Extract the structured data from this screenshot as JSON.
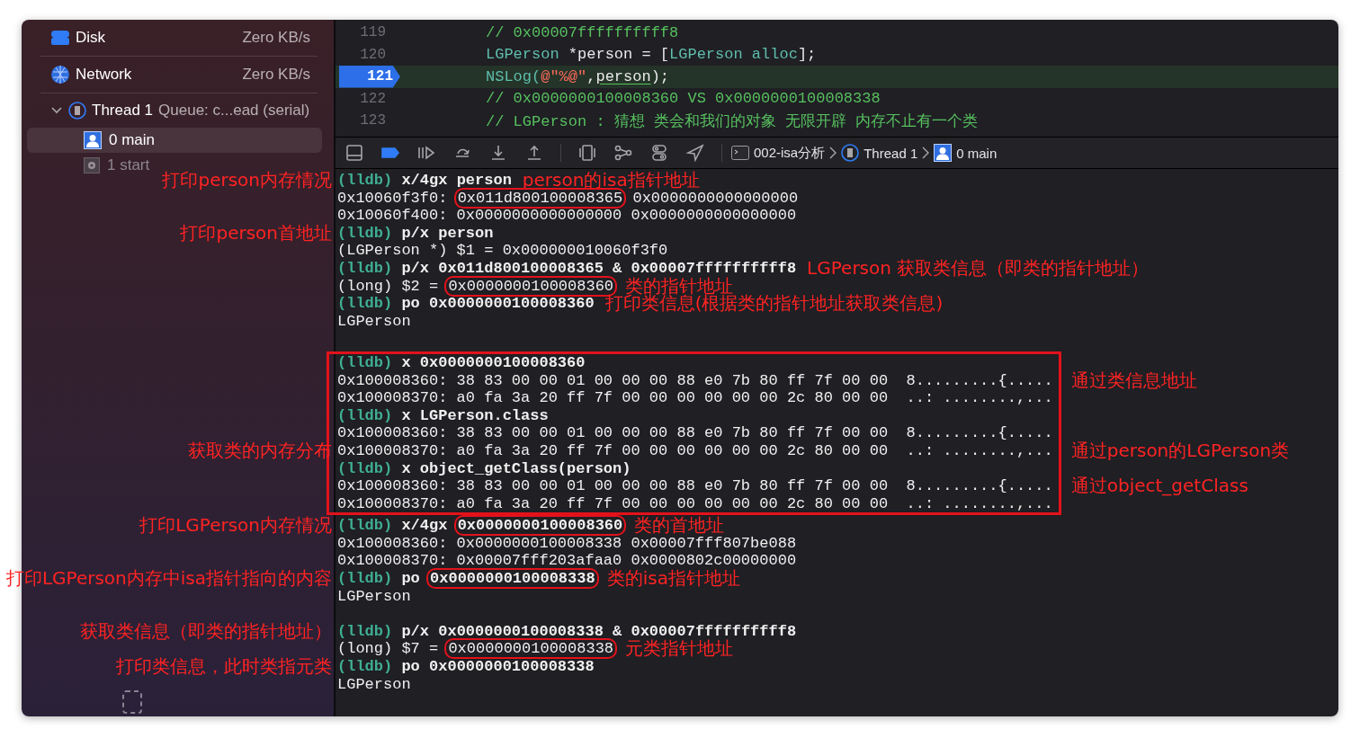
{
  "sidebar": {
    "gauges": [
      {
        "kind": "disk",
        "label": "Disk",
        "value": "Zero KB/s"
      },
      {
        "kind": "network",
        "label": "Network",
        "value": "Zero KB/s"
      }
    ],
    "thread": {
      "title": "Thread 1",
      "detail": "Queue: c...ead (serial)",
      "expanded": true,
      "frames": [
        {
          "kind": "user",
          "label": "0 main",
          "selected": true
        },
        {
          "kind": "system",
          "label": "1 start",
          "selected": false
        }
      ]
    }
  },
  "editor": {
    "lines": [
      {
        "number": "119",
        "current": false,
        "parts": [
          {
            "kind": "comment",
            "text": "// 0x00007ffffffffff8"
          }
        ]
      },
      {
        "number": "120",
        "current": false,
        "parts": [
          {
            "kind": "type",
            "text": "LGPerson"
          },
          {
            "kind": "plain",
            "text": " *person = ["
          },
          {
            "kind": "type",
            "text": "LGPerson alloc"
          },
          {
            "kind": "plain",
            "text": "];"
          }
        ]
      },
      {
        "number": "121",
        "current": true,
        "parts": [
          {
            "kind": "type",
            "text": "NSLog("
          },
          {
            "kind": "string",
            "text": "@\"%@\""
          },
          {
            "kind": "plain",
            "text": ","
          },
          {
            "kind": "underlined",
            "text": "person"
          },
          {
            "kind": "plain",
            "text": ");"
          }
        ]
      },
      {
        "number": "122",
        "current": false,
        "parts": [
          {
            "kind": "comment",
            "text": "// 0x0000000100008360 VS 0x0000000100008338"
          }
        ]
      },
      {
        "number": "123",
        "current": false,
        "parts": [
          {
            "kind": "comment",
            "text": "// LGPerson : 猜想 类会和我们的对象 无限开辟 内存不止有一个类"
          }
        ]
      }
    ]
  },
  "debug_bar": {
    "breakpoints_active": true,
    "breadcrumb": [
      {
        "kind": "target",
        "label": "002-isa分析"
      },
      {
        "kind": "thread",
        "label": "Thread 1"
      },
      {
        "kind": "frame",
        "label": "0 main"
      }
    ]
  },
  "console": {
    "blocks": [
      {
        "boxed": false,
        "lines": [
          {
            "kind": "command",
            "prompt": "(lldb)",
            "parts": [
              {
                "text": "x/4gx person",
                "circled": false
              }
            ],
            "note_left": "打印person内存情况",
            "note_right": "person的isa指针地址"
          },
          {
            "kind": "output",
            "parts": [
              {
                "text": "0x10060f3f0: ",
                "circled": false
              },
              {
                "text": "0x011d800100008365",
                "circled": true
              },
              {
                "text": " 0x0000000000000000",
                "circled": false
              }
            ]
          },
          {
            "kind": "output",
            "parts": [
              {
                "text": "0x10060f400: 0x0000000000000000 0x0000000000000000",
                "circled": false
              }
            ]
          },
          {
            "kind": "command",
            "prompt": "(lldb)",
            "parts": [
              {
                "text": "p/x person",
                "circled": false
              }
            ],
            "note_left": "打印person首地址"
          },
          {
            "kind": "output",
            "parts": [
              {
                "text": "(LGPerson *) $1 = 0x000000010060f3f0",
                "circled": false
              }
            ]
          },
          {
            "kind": "command",
            "prompt": "(lldb)",
            "parts": [
              {
                "text": "p/x 0x011d800100008365 & 0x00007ffffffffff8",
                "circled": false
              }
            ],
            "note_right": "LGPerson 获取类信息（即类的指针地址）"
          },
          {
            "kind": "output",
            "parts": [
              {
                "text": "(long) $2 = ",
                "circled": false
              },
              {
                "text": "0x0000000100008360",
                "circled": true
              }
            ],
            "note_right": "类的指针地址"
          },
          {
            "kind": "command",
            "prompt": "(lldb)",
            "parts": [
              {
                "text": "po 0x0000000100008360",
                "circled": false
              }
            ],
            "note_right": "打印类信息(根据类的指针地址获取类信息)"
          },
          {
            "kind": "output",
            "parts": [
              {
                "text": "LGPerson",
                "circled": false
              }
            ]
          },
          {
            "kind": "blank"
          }
        ]
      },
      {
        "boxed": true,
        "lines": [
          {
            "kind": "command",
            "prompt": "(lldb)",
            "parts": [
              {
                "text": "x 0x0000000100008360",
                "circled": false
              }
            ]
          },
          {
            "kind": "output",
            "parts": [
              {
                "text": "0x100008360: 38 83 00 00 01 00 00 00 88 e0 7b 80 ff 7f 00 00  8.........{.....",
                "circled": false
              }
            ],
            "note_right": "通过类信息地址"
          },
          {
            "kind": "output",
            "parts": [
              {
                "text": "0x100008370: a0 fa 3a 20 ff 7f 00 00 00 00 00 00 2c 80 00 00  ..: ........,...",
                "circled": false
              }
            ]
          },
          {
            "kind": "command",
            "prompt": "(lldb)",
            "parts": [
              {
                "text": "x LGPerson.class",
                "circled": false
              }
            ]
          },
          {
            "kind": "output",
            "parts": [
              {
                "text": "0x100008360: 38 83 00 00 01 00 00 00 88 e0 7b 80 ff 7f 00 00  8.........{.....",
                "circled": false
              }
            ]
          },
          {
            "kind": "output",
            "parts": [
              {
                "text": "0x100008370: a0 fa 3a 20 ff 7f 00 00 00 00 00 00 2c 80 00 00  ..: ........,...",
                "circled": false
              }
            ],
            "note_left": "获取类的内存分布",
            "note_right": "通过person的LGPerson类"
          },
          {
            "kind": "command",
            "prompt": "(lldb)",
            "parts": [
              {
                "text": "x object_getClass(person)",
                "circled": false
              }
            ]
          },
          {
            "kind": "output",
            "parts": [
              {
                "text": "0x100008360: 38 83 00 00 01 00 00 00 88 e0 7b 80 ff 7f 00 00  8.........{.....",
                "circled": false
              }
            ],
            "note_right": "通过object_getClass"
          },
          {
            "kind": "output",
            "parts": [
              {
                "text": "0x100008370: a0 fa 3a 20 ff 7f 00 00 00 00 00 00 2c 80 00 00  ..: ........,...",
                "circled": false
              }
            ]
          }
        ]
      },
      {
        "boxed": false,
        "lines": [
          {
            "kind": "command",
            "prompt": "(lldb)",
            "parts": [
              {
                "text": "x/4gx ",
                "circled": false
              },
              {
                "text": "0x0000000100008360",
                "circled": true
              }
            ],
            "note_left": "打印LGPerson内存情况",
            "note_right": "类的首地址"
          },
          {
            "kind": "output",
            "parts": [
              {
                "text": "0x100008360: 0x0000000100008338 0x00007fff807be088",
                "circled": false
              }
            ]
          },
          {
            "kind": "output",
            "parts": [
              {
                "text": "0x100008370: 0x00007fff203afaa0 0x0000802c00000000",
                "circled": false
              }
            ]
          },
          {
            "kind": "command",
            "prompt": "(lldb)",
            "parts": [
              {
                "text": "po ",
                "circled": false
              },
              {
                "text": "0x0000000100008338",
                "circled": true
              }
            ],
            "note_left": "打印LGPerson内存中isa指针指向的内容",
            "note_right": "类的isa指针地址"
          },
          {
            "kind": "output",
            "parts": [
              {
                "text": "LGPerson",
                "circled": false
              }
            ]
          },
          {
            "kind": "blank"
          },
          {
            "kind": "command",
            "prompt": "(lldb)",
            "parts": [
              {
                "text": "p/x 0x0000000100008338 & 0x00007ffffffffff8",
                "circled": false
              }
            ],
            "note_left": "获取类信息（即类的指针地址）"
          },
          {
            "kind": "output",
            "parts": [
              {
                "text": "(long) $7 = ",
                "circled": false
              },
              {
                "text": "0x0000000100008338",
                "circled": true
              }
            ],
            "note_right": "元类指针地址"
          },
          {
            "kind": "command",
            "prompt": "(lldb)",
            "parts": [
              {
                "text": "po 0x0000000100008338",
                "circled": false
              }
            ],
            "note_left": "打印类信息，此时类指元类"
          },
          {
            "kind": "output",
            "parts": [
              {
                "text": "LGPerson",
                "circled": false
              }
            ]
          }
        ]
      }
    ]
  }
}
